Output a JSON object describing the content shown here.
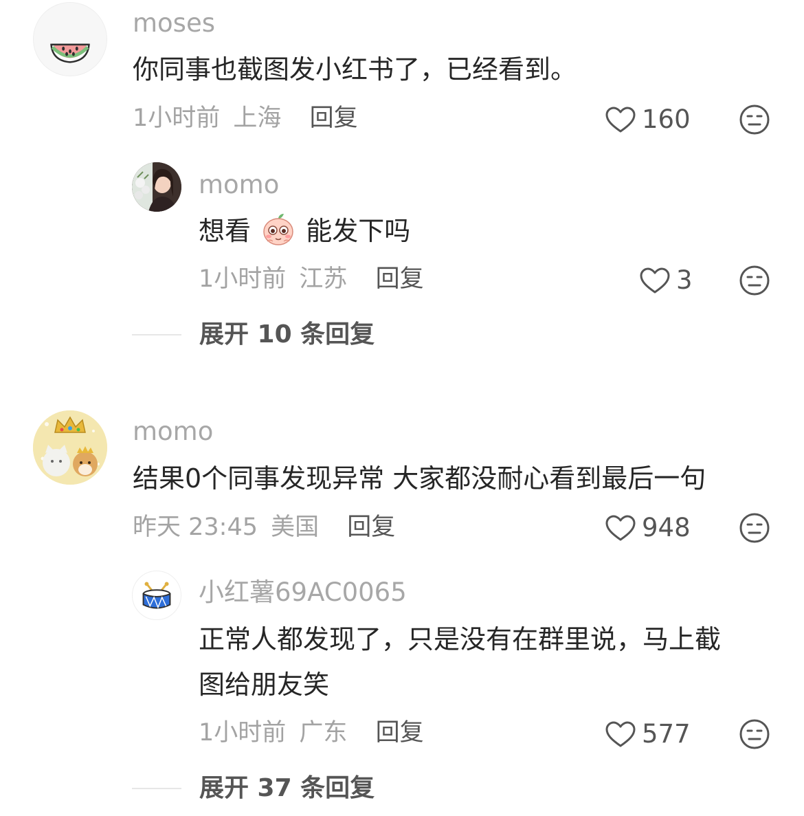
{
  "threads": [
    {
      "comment": {
        "avatar": "watermelon-avatar",
        "username": "moses",
        "text": "你同事也截图发小红书了，已经看到。",
        "time": "1小时前",
        "location": "上海",
        "reply_label": "回复",
        "likes": "160"
      },
      "replies": [
        {
          "avatar": "girl-photo-avatar",
          "username": "momo",
          "text_before": "想看",
          "emoji": "peach-face-emoji",
          "text_after": "能发下吗",
          "time": "1小时前",
          "location": "江苏",
          "reply_label": "回复",
          "likes": "3"
        }
      ],
      "expand_label": "展开 10 条回复"
    },
    {
      "comment": {
        "avatar": "cat-dog-crown-avatar",
        "username": "momo",
        "text": "结果0个同事发现异常 大家都没耐心看到最后一句",
        "time": "昨天 23:45",
        "location": "美国",
        "reply_label": "回复",
        "likes": "948"
      },
      "replies": [
        {
          "avatar": "drum-avatar",
          "username": "小红薯69AC0065",
          "text_line1": "正常人都发现了，只是没有在群里说，马上截",
          "text_line2": "图给朋友笑",
          "time": "1小时前",
          "location": "广东",
          "reply_label": "回复",
          "likes": "577"
        }
      ],
      "expand_label": "展开 37 条回复"
    }
  ],
  "icons": {
    "like": "heart-outline-icon",
    "dislike": "neutral-face-icon"
  },
  "colors": {
    "username": "#a7a7a7",
    "meta": "#a3a3a3",
    "text": "#262626",
    "action": "#555555"
  }
}
